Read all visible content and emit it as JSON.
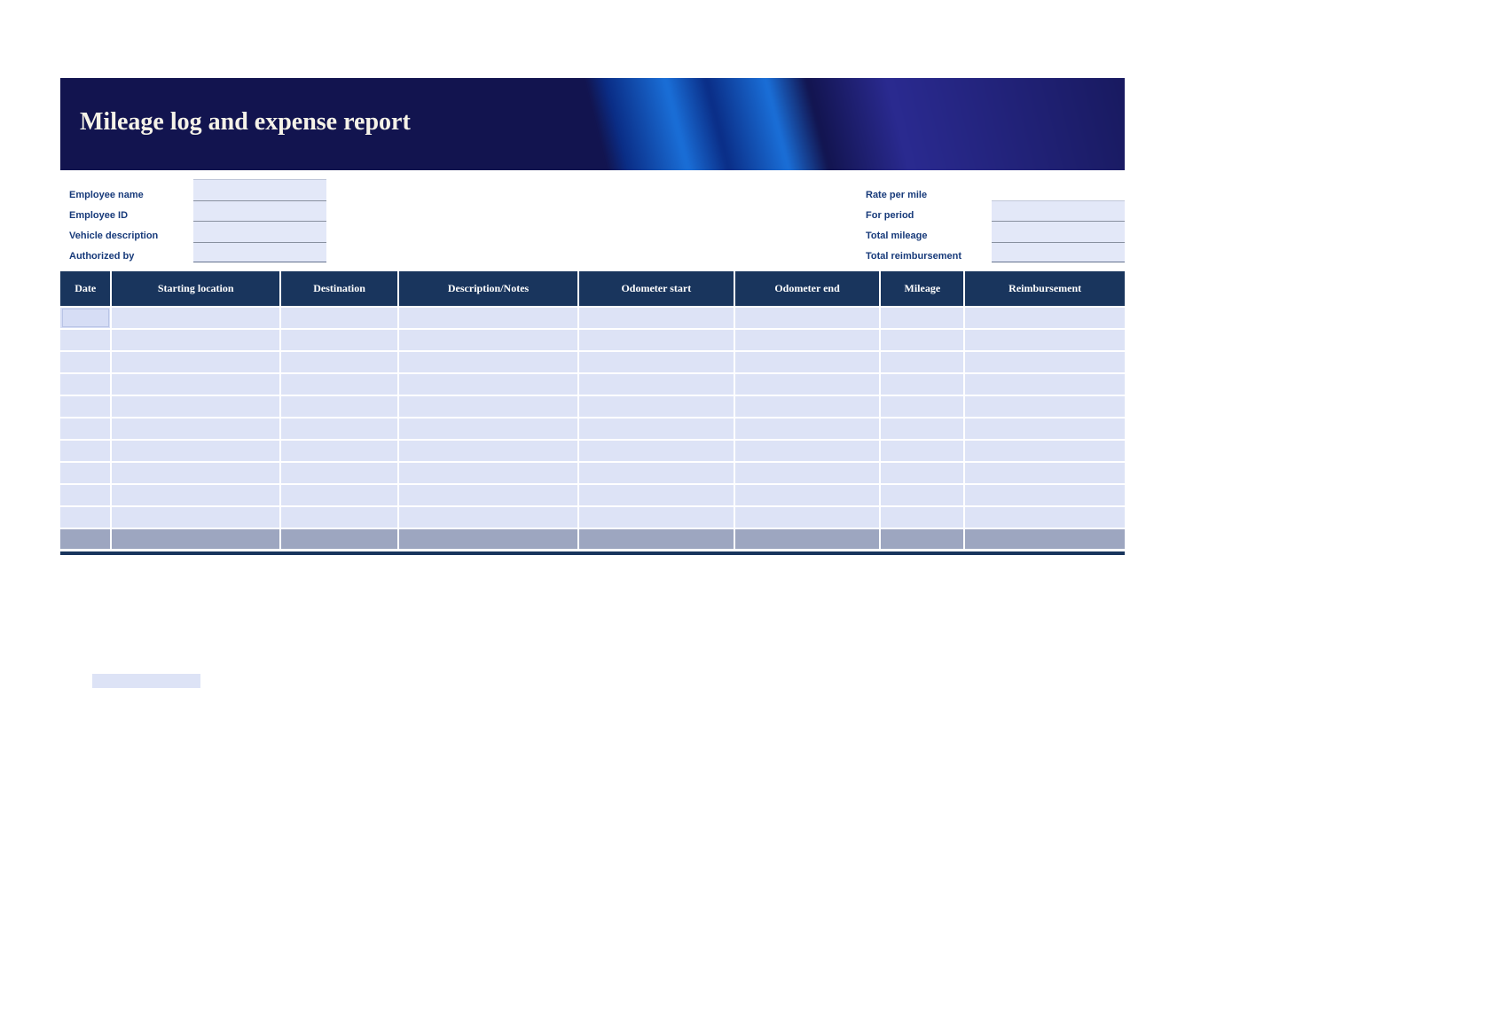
{
  "header": {
    "title": "Mileage log and expense report"
  },
  "form": {
    "left": [
      {
        "label": "Employee name",
        "value": ""
      },
      {
        "label": "Employee ID",
        "value": ""
      },
      {
        "label": "Vehicle description",
        "value": ""
      },
      {
        "label": "Authorized by",
        "value": ""
      }
    ],
    "right": [
      {
        "label": "Rate per mile",
        "value": ""
      },
      {
        "label": "For period",
        "value": ""
      },
      {
        "label": "Total mileage",
        "value": ""
      },
      {
        "label": "Total reimbursement",
        "value": ""
      }
    ]
  },
  "table": {
    "columns": [
      "Date",
      "Starting location",
      "Destination",
      "Description/Notes",
      "Odometer start",
      "Odometer end",
      "Mileage",
      "Reimbursement"
    ],
    "rows": [
      [
        "",
        "",
        "",
        "",
        "",
        "",
        "",
        ""
      ],
      [
        "",
        "",
        "",
        "",
        "",
        "",
        "",
        ""
      ],
      [
        "",
        "",
        "",
        "",
        "",
        "",
        "",
        ""
      ],
      [
        "",
        "",
        "",
        "",
        "",
        "",
        "",
        ""
      ],
      [
        "",
        "",
        "",
        "",
        "",
        "",
        "",
        ""
      ],
      [
        "",
        "",
        "",
        "",
        "",
        "",
        "",
        ""
      ],
      [
        "",
        "",
        "",
        "",
        "",
        "",
        "",
        ""
      ],
      [
        "",
        "",
        "",
        "",
        "",
        "",
        "",
        ""
      ],
      [
        "",
        "",
        "",
        "",
        "",
        "",
        "",
        ""
      ],
      [
        "",
        "",
        "",
        "",
        "",
        "",
        "",
        ""
      ]
    ],
    "footer": [
      "",
      "",
      "",
      "",
      "",
      "",
      "",
      ""
    ]
  }
}
